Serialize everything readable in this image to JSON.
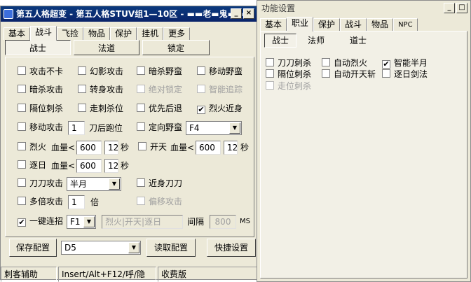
{
  "main": {
    "title": "第五人格超变 - 第五人格STUV组1—10区 - ▬▬老▬鬼▬▬",
    "tabs": [
      "基本",
      "战斗",
      "飞捡",
      "物品",
      "保护",
      "挂机",
      "更多"
    ],
    "subtabs": [
      "战士",
      "法道",
      "锁定"
    ],
    "checks": {
      "attack_no_stuck": "攻击不卡",
      "phantom_attack": "幻影攻击",
      "assassinate_savage": "暗杀野蛮",
      "move_savage": "移动野蛮",
      "assassin_attack": "暗杀攻击",
      "turn_attack": "转身攻击",
      "absolute_lock": "绝对锁定",
      "smart_track": "智能追踪",
      "cross_stab": "隔位刺杀",
      "walk_stab": "走刺杀位",
      "priority_retreat": "优先后退",
      "fire_close": "烈火近身",
      "move_attack": "移动攻击",
      "blade_run_suffix": "刀后跑位",
      "directed_savage": "定向野蛮",
      "fire": "烈火",
      "open_sky": "开天",
      "chase_sun": "逐日",
      "blade_attack": "刀刀攻击",
      "close_blade": "近身刀刀",
      "multi_attack": "多倍攻击",
      "multi_suffix": "倍",
      "offset_attack": "偏移攻击",
      "combo_key": "一键连招",
      "interval": "间隔",
      "ms": "MS"
    },
    "hp_label": "血量<",
    "sec_label": "秒",
    "values": {
      "move_attack_num": "1",
      "directed_key": "F4",
      "fire_hp": "600",
      "fire_sec": "12",
      "open_hp": "600",
      "open_sec": "12",
      "sun_hp": "600",
      "sun_sec": "12",
      "blade_mode": "半月",
      "multi_num": "1",
      "combo_hotkey": "F1",
      "combo_skills": "烈火|开天|逐日",
      "interval_ms": "800"
    },
    "buttons": {
      "save_config": "保存配置",
      "config_name": "D5",
      "read_config": "读取配置",
      "quick_settings": "快捷设置"
    },
    "status": {
      "assist": "刺客辅助",
      "hotkey": "Insert/Alt+F12/呼/隐",
      "edition": "收费版"
    }
  },
  "func": {
    "title": "功能设置",
    "tabs": [
      "基本",
      "职业",
      "保护",
      "战斗",
      "物品",
      "NPC"
    ],
    "subtabs": [
      "战士",
      "法师",
      "道士"
    ],
    "checks": {
      "blade_stab": "刀刀刺杀",
      "auto_fire": "自动烈火",
      "smart_half_moon": "智能半月",
      "cross_stab": "隔位刺杀",
      "auto_open_sky": "自动开天斩",
      "chase_sun_sword": "逐日剑法",
      "walk_stab": "走位刺杀"
    }
  },
  "icons": {
    "check": "✔",
    "dropdown": "▼",
    "minimize": "_",
    "maximize": "□",
    "close": "×"
  },
  "colors": {
    "titlebar": "#0a246a",
    "face": "#ece9d8",
    "disabled": "#a0a0a0"
  }
}
